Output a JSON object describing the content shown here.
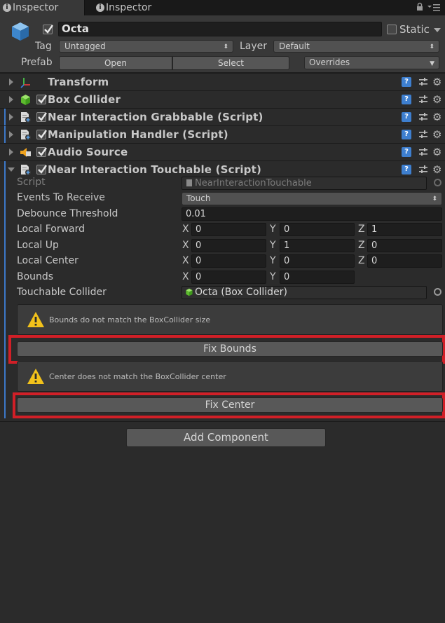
{
  "tabs": [
    {
      "label": "Inspector"
    },
    {
      "label": "Inspector"
    }
  ],
  "header": {
    "object_name": "Octa",
    "static_label": "Static",
    "tag_label": "Tag",
    "tag_value": "Untagged",
    "layer_label": "Layer",
    "layer_value": "Default",
    "prefab_label": "Prefab",
    "open_label": "Open",
    "select_label": "Select",
    "overrides_label": "Overrides"
  },
  "components": [
    {
      "title": "Transform",
      "icon": "transform-icon"
    },
    {
      "title": "Box Collider",
      "icon": "box-collider-icon"
    },
    {
      "title": "Near Interaction Grabbable (Script)",
      "icon": "script-icon"
    },
    {
      "title": "Manipulation Handler (Script)",
      "icon": "script-icon"
    },
    {
      "title": "Audio Source",
      "icon": "audio-source-icon"
    },
    {
      "title": "Near Interaction Touchable (Script)",
      "icon": "script-icon"
    }
  ],
  "touchable": {
    "script_label": "Script",
    "script_value": "NearInteractionTouchable",
    "events_label": "Events To Receive",
    "events_value": "Touch",
    "debounce_label": "Debounce Threshold",
    "debounce_value": "0.01",
    "local_forward": {
      "label": "Local Forward",
      "x": "0",
      "y": "0",
      "z": "1"
    },
    "local_up": {
      "label": "Local Up",
      "x": "0",
      "y": "1",
      "z": "0"
    },
    "local_center": {
      "label": "Local Center",
      "x": "0",
      "y": "0",
      "z": "0"
    },
    "bounds": {
      "label": "Bounds",
      "x": "0",
      "y": "0"
    },
    "touchable_collider_label": "Touchable Collider",
    "touchable_collider_value": "Octa (Box Collider)",
    "axis_x": "X",
    "axis_y": "Y",
    "axis_z": "Z",
    "bounds_warning": "Bounds do not match the BoxCollider size",
    "fix_bounds_label": "Fix Bounds",
    "center_warning": "Center does not match the BoxCollider center",
    "fix_center_label": "Fix Center"
  },
  "add_component_label": "Add Component",
  "colors": {
    "highlight": "#d11f27",
    "help_blue": "#3e7fcf",
    "warning_yellow": "#f2c21b"
  }
}
